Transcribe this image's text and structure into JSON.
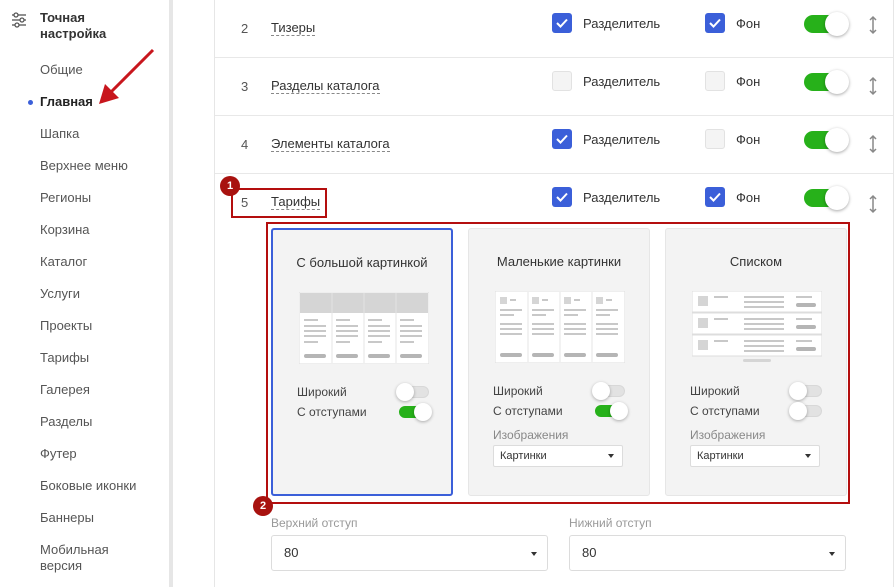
{
  "sidebar": {
    "title": "Точная настройка",
    "items": [
      {
        "label": "Общие"
      },
      {
        "label": "Главная"
      },
      {
        "label": "Шапка"
      },
      {
        "label": "Верхнее меню"
      },
      {
        "label": "Регионы"
      },
      {
        "label": "Корзина"
      },
      {
        "label": "Каталог"
      },
      {
        "label": "Услуги"
      },
      {
        "label": "Проекты"
      },
      {
        "label": "Тарифы"
      },
      {
        "label": "Галерея"
      },
      {
        "label": "Разделы"
      },
      {
        "label": "Футер"
      },
      {
        "label": "Боковые иконки"
      },
      {
        "label": "Баннеры"
      },
      {
        "label": "Мобильная версия"
      }
    ]
  },
  "rows": [
    {
      "num": "2",
      "label": "Тизеры",
      "divider_label": "Разделитель",
      "divider_checked": true,
      "bg_label": "Фон",
      "bg_checked": true,
      "enabled": true
    },
    {
      "num": "3",
      "label": "Разделы каталога",
      "divider_label": "Разделитель",
      "divider_checked": false,
      "bg_label": "Фон",
      "bg_checked": false,
      "enabled": true
    },
    {
      "num": "4",
      "label": "Элементы каталога",
      "divider_label": "Разделитель",
      "divider_checked": true,
      "bg_label": "Фон",
      "bg_checked": false,
      "enabled": true
    },
    {
      "num": "5",
      "label": "Тарифы",
      "divider_label": "Разделитель",
      "divider_checked": true,
      "bg_label": "Фон",
      "bg_checked": true,
      "enabled": true
    }
  ],
  "annotations": {
    "badge1": "1",
    "badge2": "2"
  },
  "cards": [
    {
      "title": "С большой картинкой",
      "selected": true,
      "wide_label": "Широкий",
      "wide_on": false,
      "padding_label": "С отступами",
      "padding_on": true
    },
    {
      "title": "Маленькие картинки",
      "selected": false,
      "wide_label": "Широкий",
      "wide_on": false,
      "padding_label": "С отступами",
      "padding_on": true,
      "images_label": "Изображения",
      "images_value": "Картинки"
    },
    {
      "title": "Списком",
      "selected": false,
      "wide_label": "Широкий",
      "wide_on": false,
      "padding_label": "С отступами",
      "padding_on": false,
      "images_label": "Изображения",
      "images_value": "Картинки"
    }
  ],
  "spacing": {
    "top_label": "Верхний отступ",
    "top_value": "80",
    "bottom_label": "Нижний отступ",
    "bottom_value": "80"
  },
  "colors": {
    "accent": "#3b5fd9",
    "toggle_on": "#27b11a",
    "annotation": "#b40e0e"
  }
}
